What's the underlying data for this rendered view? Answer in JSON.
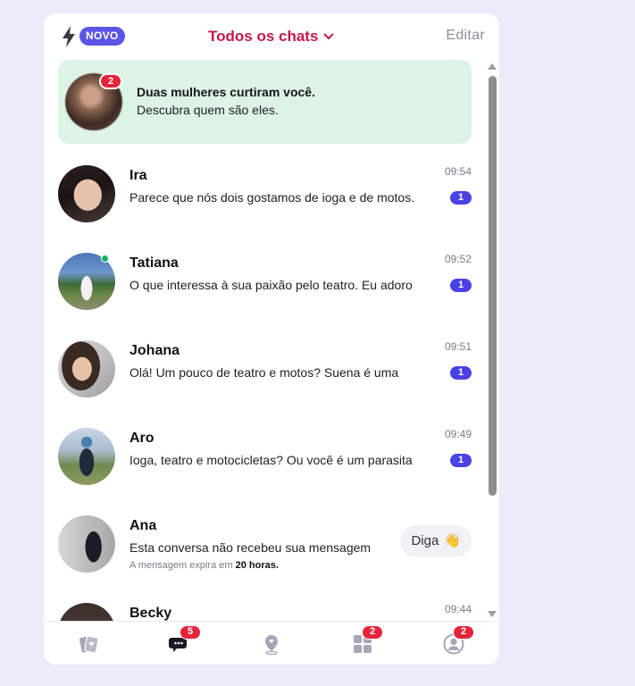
{
  "header": {
    "badge": "NOVO",
    "title": "Todos os chats",
    "edit": "Editar"
  },
  "banner": {
    "count": "2",
    "title": "Duas mulheres curtiram você.",
    "subtitle": "Descubra quem são eles."
  },
  "chats": [
    {
      "name": "Ira",
      "time": "09:54",
      "message": "Parece que nós dois gostamos de ioga e de motos.",
      "unread": "1"
    },
    {
      "name": "Tatiana",
      "time": "09:52",
      "message": "O que interessa à sua paixão pelo teatro. Eu adoro",
      "unread": "1",
      "online": true
    },
    {
      "name": "Johana",
      "time": "09:51",
      "message": "Olá! Um pouco de teatro e motos? Suena é uma",
      "unread": "1"
    },
    {
      "name": "Aro",
      "time": "09:49",
      "message": "Ioga, teatro e motocicletas? Ou você é um parasita",
      "unread": "1"
    },
    {
      "name": "Ana",
      "message": "Esta conversa não recebeu sua mensagem",
      "expire_prefix": "A mensagem expira em",
      "expire_value": "20 horas.",
      "action": "Diga",
      "action_emoji": "👋"
    },
    {
      "name": "Becky",
      "time": "09:44"
    }
  ],
  "nav": {
    "chats_badge": "5",
    "discover_badge": "2",
    "profile_badge": "2"
  },
  "colors": {
    "accent": "#c4184a",
    "brand": "#5b54e8",
    "unread": "#4a42e3",
    "badge": "#e5243b",
    "banner_bg": "#dcf3e6"
  }
}
